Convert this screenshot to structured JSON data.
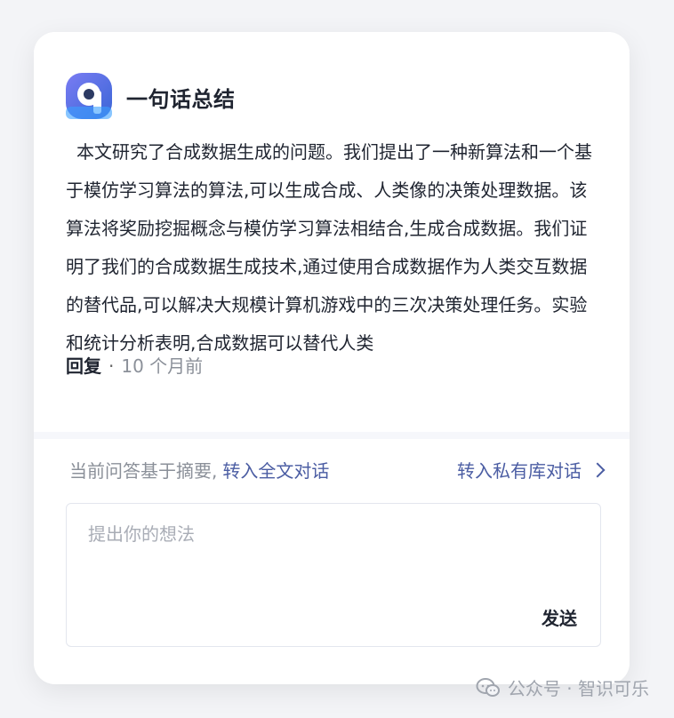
{
  "card": {
    "title": "一句话总结",
    "summary": "本文研究了合成数据生成的问题。我们提出了一种新算法和一个基于模仿学习算法的算法,可以生成合成、人类像的决策处理数据。该算法将奖励挖掘概念与模仿学习算法相结合,生成合成数据。我们证明了我们的合成数据生成技术,通过使用合成数据作为人类交互数据的替代品,可以解决大规模计算机游戏中的三次决策处理任务。实验和统计分析表明,合成数据可以替代人类",
    "meta": {
      "reply": "回复",
      "separator": "·",
      "time": "10 个月前"
    }
  },
  "chat": {
    "basis_text": "当前问答基于摘要,",
    "basis_link": "转入全文对话",
    "private_link": "转入私有库对话",
    "input_placeholder": "提出你的想法",
    "send_label": "发送"
  },
  "watermark": {
    "text": "公众号 · 智识可乐",
    "icon": "wechat-icon"
  },
  "colors": {
    "accent_blue": "#4b5da3",
    "text_dark": "#1f2430",
    "text_muted": "#8b9099"
  },
  "icons": {
    "brand_logo": "brand-logo-icon",
    "chevron": "chevron-right-icon"
  }
}
